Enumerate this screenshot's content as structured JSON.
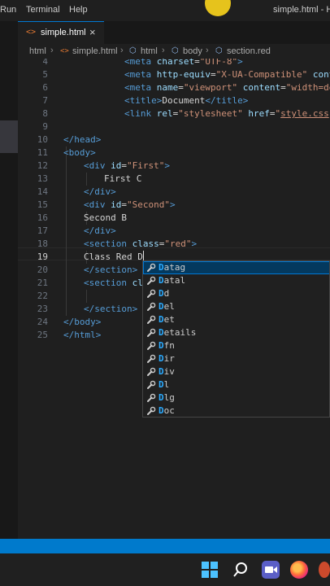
{
  "menu": {
    "items": [
      "Run",
      "Terminal",
      "Help"
    ]
  },
  "window_title": "simple.html - H",
  "tab": {
    "label": "simple.html",
    "icon_text": "<>",
    "close": "×"
  },
  "breadcrumb": [
    "html",
    "simple.html",
    "html",
    "body",
    "section.red"
  ],
  "editor": {
    "line_numbers": [
      "4",
      "5",
      "6",
      "7",
      "8",
      "9",
      "10",
      "11",
      "12",
      "13",
      "14",
      "15",
      "16",
      "17",
      "18",
      "19",
      "20",
      "21",
      "22",
      "23",
      "24",
      "25"
    ],
    "active_line": "19",
    "lines": [
      [
        {
          "t": "<meta ",
          "c": "tag"
        },
        {
          "t": "charset",
          "c": "attr"
        },
        {
          "t": "=",
          "c": "txt"
        },
        {
          "t": "\"UTF-8\"",
          "c": "str"
        },
        {
          "t": ">",
          "c": "tag"
        }
      ],
      [
        {
          "t": "<meta ",
          "c": "tag"
        },
        {
          "t": "http-equiv",
          "c": "attr"
        },
        {
          "t": "=",
          "c": "txt"
        },
        {
          "t": "\"X-UA-Compatible\"",
          "c": "str"
        },
        {
          "t": " ",
          "c": "txt"
        },
        {
          "t": "content",
          "c": "attr"
        },
        {
          "t": "=",
          "c": "txt"
        },
        {
          "t": "\"IE=",
          "c": "str"
        }
      ],
      [
        {
          "t": "<meta ",
          "c": "tag"
        },
        {
          "t": "name",
          "c": "attr"
        },
        {
          "t": "=",
          "c": "txt"
        },
        {
          "t": "\"viewport\"",
          "c": "str"
        },
        {
          "t": " ",
          "c": "txt"
        },
        {
          "t": "content",
          "c": "attr"
        },
        {
          "t": "=",
          "c": "txt"
        },
        {
          "t": "\"width=device-wid",
          "c": "str"
        }
      ],
      [
        {
          "t": "<title>",
          "c": "tag"
        },
        {
          "t": "Document",
          "c": "txt"
        },
        {
          "t": "</title>",
          "c": "tag"
        }
      ],
      [
        {
          "t": "<link ",
          "c": "tag"
        },
        {
          "t": "rel",
          "c": "attr"
        },
        {
          "t": "=",
          "c": "txt"
        },
        {
          "t": "\"stylesheet\"",
          "c": "str"
        },
        {
          "t": " ",
          "c": "txt"
        },
        {
          "t": "href",
          "c": "attr"
        },
        {
          "t": "=",
          "c": "txt"
        },
        {
          "t": "\"",
          "c": "str"
        },
        {
          "t": "style.css",
          "c": "str",
          "u": true
        },
        {
          "t": "\"",
          "c": "str"
        },
        {
          "t": ">",
          "c": "tag"
        }
      ],
      [],
      [
        {
          "t": "</head>",
          "c": "tag"
        }
      ],
      [
        {
          "t": "<body>",
          "c": "tag"
        }
      ],
      [
        {
          "t": "<div ",
          "c": "tag"
        },
        {
          "t": "id",
          "c": "attr"
        },
        {
          "t": "=",
          "c": "txt"
        },
        {
          "t": "\"First\"",
          "c": "str"
        },
        {
          "t": ">",
          "c": "tag"
        }
      ],
      [
        {
          "t": "First C",
          "c": "txt"
        }
      ],
      [
        {
          "t": "</div>",
          "c": "tag"
        }
      ],
      [
        {
          "t": "<div ",
          "c": "tag"
        },
        {
          "t": "id",
          "c": "attr"
        },
        {
          "t": "=",
          "c": "txt"
        },
        {
          "t": "\"Second\"",
          "c": "str"
        },
        {
          "t": ">",
          "c": "tag"
        }
      ],
      [
        {
          "t": "Second B",
          "c": "txt"
        }
      ],
      [
        {
          "t": "</div>",
          "c": "tag"
        }
      ],
      [
        {
          "t": "<section ",
          "c": "tag"
        },
        {
          "t": "class",
          "c": "attr"
        },
        {
          "t": "=",
          "c": "txt"
        },
        {
          "t": "\"red\"",
          "c": "str"
        },
        {
          "t": ">",
          "c": "tag"
        }
      ],
      [
        {
          "t": "Class Red D",
          "c": "txt"
        }
      ],
      [
        {
          "t": "</section>",
          "c": "tag"
        }
      ],
      [
        {
          "t": "<section ",
          "c": "tag"
        },
        {
          "t": "cl",
          "c": "attr"
        }
      ],
      [],
      [
        {
          "t": "</section>",
          "c": "tag"
        }
      ],
      [
        {
          "t": "</body>",
          "c": "tag"
        }
      ],
      [
        {
          "t": "</html>",
          "c": "tag"
        }
      ]
    ]
  },
  "suggestions": {
    "typed": "D",
    "icon": "wrench-icon",
    "items": [
      "Datag",
      "Datal",
      "Dd",
      "Del",
      "Det",
      "Details",
      "Dfn",
      "Dir",
      "Div",
      "Dl",
      "Dlg",
      "Doc"
    ]
  },
  "colors": {
    "accent": "#0078d4",
    "status_bar": "#007acc",
    "tag": "#569cd6",
    "attr": "#9cdcfe",
    "string": "#ce9178"
  }
}
